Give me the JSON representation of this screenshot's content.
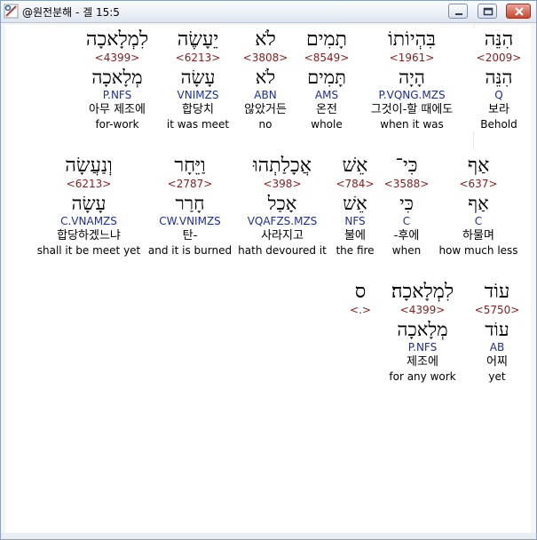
{
  "window": {
    "title": "@원전분해 - 겔 15:5",
    "icons": {
      "app": "hebrew-tool-icon",
      "minimize": "minimize-icon",
      "maximize": "maximize-icon",
      "close": "close-icon"
    }
  },
  "rows": [
    {
      "words": [
        {
          "heb": "הִנֵּה",
          "num": "<2009>",
          "lemma": "הִנֵּה",
          "morph": "Q",
          "kor": "보라",
          "eng": "Behold"
        },
        {
          "heb": "בִּהְיוֹתוֹ",
          "num": "<1961>",
          "lemma": "הָיָה",
          "morph": "P.VQNG.MZS",
          "kor": "그것이-할 때에도",
          "eng": "when it was"
        },
        {
          "heb": "תָמִים",
          "num": "<8549>",
          "lemma": "תָּמִים",
          "morph": "AMS",
          "kor": "온전",
          "eng": "whole"
        },
        {
          "heb": "לֹא",
          "num": "<3808>",
          "lemma": "לֹא",
          "morph": "ABN",
          "kor": "않았거든",
          "eng": "no"
        },
        {
          "heb": "יֵעָשֶׂה",
          "num": "<6213>",
          "lemma": "עָשָׂה",
          "morph": "VNIMZS",
          "kor": "합당치",
          "eng": "it was meet"
        },
        {
          "heb": "לִמְלָאכָה",
          "num": "<4399>",
          "lemma": "מְלָאכָה",
          "morph": "P.NFS",
          "kor": "아무 제조에",
          "eng": "for-work"
        }
      ]
    },
    {
      "words": [
        {
          "heb": "אַף",
          "num": "<637>",
          "lemma": "אַף",
          "morph": "C",
          "kor": "하물며",
          "eng": "how much less"
        },
        {
          "heb": "כִּי־",
          "num": "<3588>",
          "lemma": "כִּי",
          "morph": "C",
          "kor": "-후에",
          "eng": "when"
        },
        {
          "heb": "אֵשׁ",
          "num": "<784>",
          "lemma": "אֵשׁ",
          "morph": "NFS",
          "kor": "불에",
          "eng": "the fire"
        },
        {
          "heb": "אֲכָלַתְהוּ",
          "num": "<398>",
          "lemma": "אָכַל",
          "morph": "VQAFZS.MZS",
          "kor": "사라지고",
          "eng": "hath devoured it"
        },
        {
          "heb": "וַיֵּחָר",
          "num": "<2787>",
          "lemma": "חָרַר",
          "morph": "CW.VNIMZS",
          "kor": "탄-",
          "eng": "and it is burned"
        },
        {
          "heb": "וְנַעֲשָׂה",
          "num": "<6213>",
          "lemma": "עָשָׂה",
          "morph": "C.VNAMZS",
          "kor": "합당하겠느냐",
          "eng": "shall it be meet yet"
        }
      ]
    },
    {
      "words": [
        {
          "heb": "עוֹד",
          "num": "<5750>",
          "lemma": "עוֹד",
          "morph": "AB",
          "kor": "어찌",
          "eng": "yet"
        },
        {
          "heb": "לִמְלָאכָה׃",
          "num": "<4399>",
          "lemma": "מְלָאכָה",
          "morph": "P.NFS",
          "kor": "제조에",
          "eng": "for any work"
        },
        {
          "heb": "ס",
          "num": "<.>",
          "lemma": "",
          "morph": "",
          "kor": "",
          "eng": ""
        }
      ]
    }
  ]
}
